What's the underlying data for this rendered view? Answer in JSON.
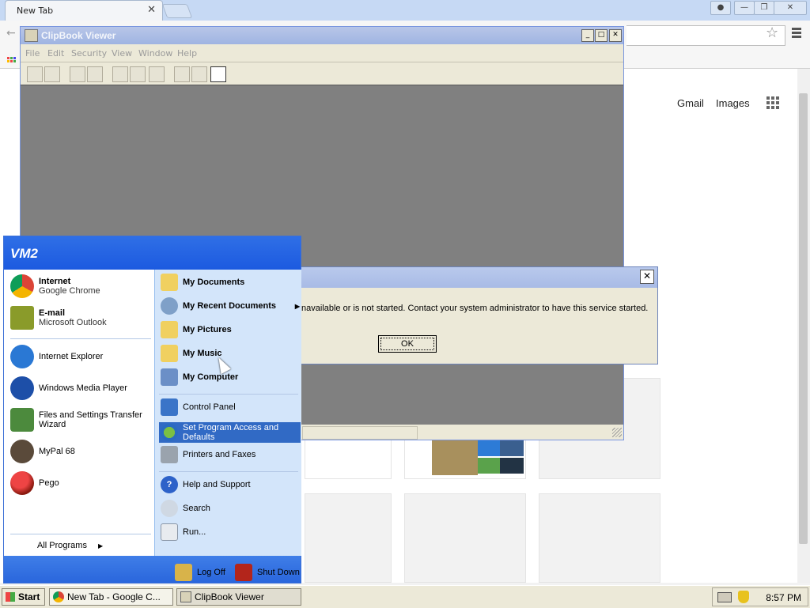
{
  "chrome": {
    "tab_title": "New Tab",
    "tab_close": "✕",
    "header_links": [
      "Gmail",
      "Images"
    ]
  },
  "clipbook": {
    "title": "ClipBook Viewer",
    "menu": [
      "File",
      "Edit",
      "Security",
      "View",
      "Window",
      "Help"
    ]
  },
  "dialog": {
    "message": "navailable or is not started. Contact your system administrator to have this service started.",
    "ok_label": "OK"
  },
  "start_menu": {
    "user": "VM2",
    "pinned": [
      {
        "title": "Internet",
        "subtitle": "Google Chrome"
      },
      {
        "title": "E-mail",
        "subtitle": "Microsoft Outlook"
      }
    ],
    "recent": [
      "Internet Explorer",
      "Windows Media Player",
      "Files and Settings Transfer Wizard",
      "MyPal 68",
      "Pego"
    ],
    "all_programs": "All Programs",
    "places": [
      "My Documents",
      "My Recent Documents",
      "My Pictures",
      "My Music",
      "My Computer"
    ],
    "settings": [
      "Control Panel",
      "Set Program Access and Defaults",
      "Printers and Faxes"
    ],
    "help": [
      "Help and Support",
      "Search",
      "Run..."
    ],
    "log_off": "Log Off",
    "shut_down": "Shut Down"
  },
  "taskbar": {
    "start": "Start",
    "tasks": [
      "New Tab - Google C...",
      "ClipBook Viewer"
    ],
    "clock": "8:57 PM"
  }
}
